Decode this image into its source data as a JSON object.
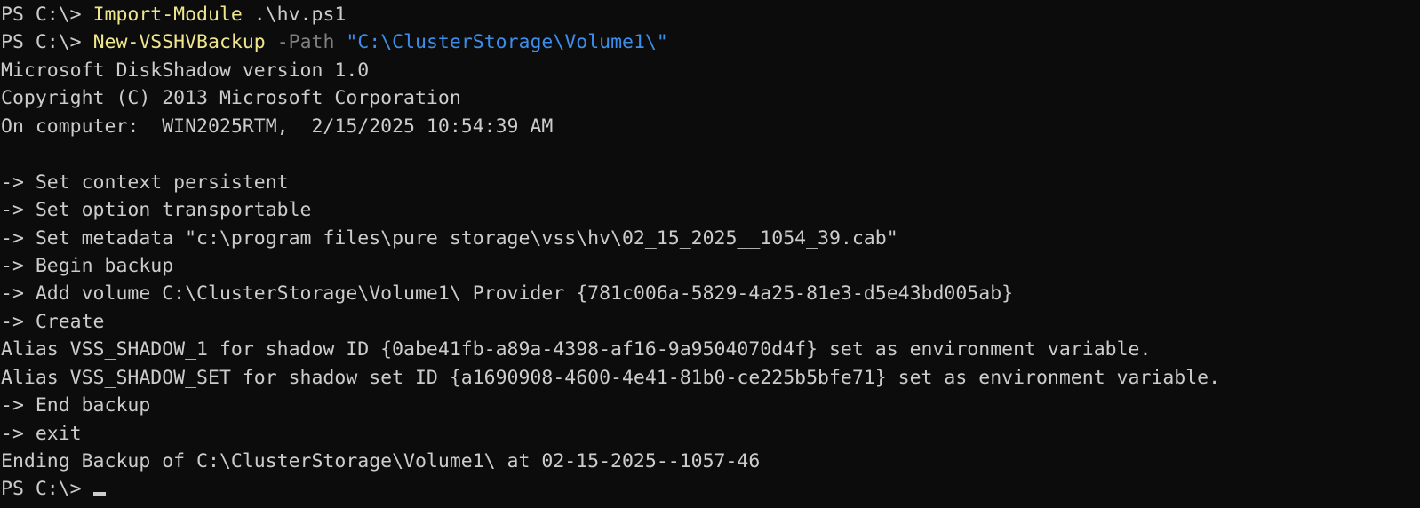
{
  "terminal": {
    "shell": "PowerShell",
    "prompt": "PS C:\\>",
    "background_color": "#0c0c0c",
    "foreground_color": "#cccccc",
    "cmdlet_color": "#f0e68c",
    "parameter_color": "#808080",
    "string_color": "#3b8eea",
    "cursor_glyph": "block-cursor"
  },
  "lines": [
    {
      "type": "command",
      "prompt": "PS C:\\>",
      "space1": " ",
      "cmdlet": "Import-Module",
      "space2": " ",
      "plain": ".\\hv.ps1"
    },
    {
      "type": "command",
      "prompt": "PS C:\\>",
      "space1": " ",
      "cmdlet": "New-VSSHVBackup",
      "space2": " ",
      "param": "-Path",
      "space3": " ",
      "string": "\"C:\\ClusterStorage\\Volume1\\\""
    },
    {
      "type": "output",
      "text": "Microsoft DiskShadow version 1.0"
    },
    {
      "type": "output",
      "text": "Copyright (C) 2013 Microsoft Corporation"
    },
    {
      "type": "output",
      "text": "On computer:  WIN2025RTM,  2/15/2025 10:54:39 AM"
    },
    {
      "type": "blank",
      "text": " "
    },
    {
      "type": "output",
      "text": "-> Set context persistent"
    },
    {
      "type": "output",
      "text": "-> Set option transportable"
    },
    {
      "type": "output",
      "text": "-> Set metadata \"c:\\program files\\pure storage\\vss\\hv\\02_15_2025__1054_39.cab\""
    },
    {
      "type": "output",
      "text": "-> Begin backup"
    },
    {
      "type": "output",
      "text": "-> Add volume C:\\ClusterStorage\\Volume1\\ Provider {781c006a-5829-4a25-81e3-d5e43bd005ab}"
    },
    {
      "type": "output",
      "text": "-> Create"
    },
    {
      "type": "output",
      "text": "Alias VSS_SHADOW_1 for shadow ID {0abe41fb-a89a-4398-af16-9a9504070d4f} set as environment variable."
    },
    {
      "type": "output",
      "text": "Alias VSS_SHADOW_SET for shadow set ID {a1690908-4600-4e41-81b0-ce225b5bfe71} set as environment variable."
    },
    {
      "type": "output",
      "text": "-> End backup"
    },
    {
      "type": "output",
      "text": "-> exit"
    },
    {
      "type": "output",
      "text": "Ending Backup of C:\\ClusterStorage\\Volume1\\ at 02-15-2025--1057-46"
    },
    {
      "type": "prompt_cursor",
      "prompt": "PS C:\\>",
      "space1": " "
    }
  ]
}
